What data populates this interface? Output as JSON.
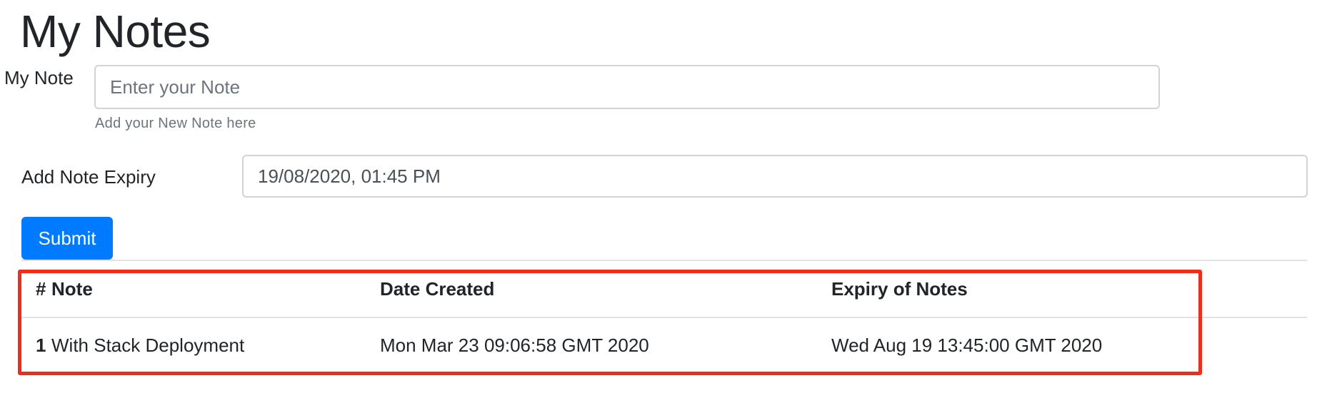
{
  "page": {
    "title": "My Notes"
  },
  "form": {
    "note_label": "My Note",
    "note_placeholder": "Enter your Note",
    "note_help": "Add your New Note here",
    "expiry_label": "Add Note Expiry",
    "expiry_value": "19/08/2020, 01:45 PM",
    "submit_label": "Submit"
  },
  "table": {
    "headers": {
      "num": "#",
      "note": "Note",
      "date_created": "Date Created",
      "expiry": "Expiry of Notes"
    },
    "rows": [
      {
        "num": "1",
        "note": "With Stack Deployment",
        "date_created": "Mon Mar 23 09:06:58 GMT 2020",
        "expiry": "Wed Aug 19 13:45:00 GMT 2020"
      }
    ]
  },
  "colors": {
    "primary": "#007bff",
    "highlight": "#f02d1a",
    "text": "#212529",
    "muted": "#6c757d",
    "border": "#ced4da"
  }
}
